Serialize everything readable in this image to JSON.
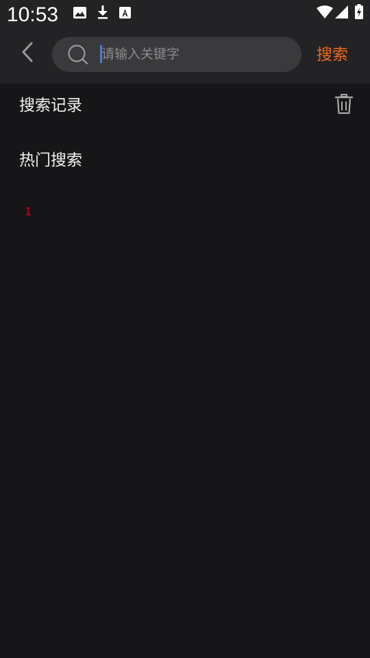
{
  "status_bar": {
    "time": "10:53",
    "icons": [
      "image-icon",
      "download-icon",
      "font-icon",
      "wifi-icon",
      "signal-icon",
      "battery-charging-icon"
    ]
  },
  "app_bar": {
    "back_icon": "chevron-left-icon",
    "search": {
      "placeholder": "请输入关键字",
      "value": ""
    },
    "search_label": "搜索"
  },
  "history": {
    "title": "搜索记录",
    "clear_icon": "trash-icon",
    "items": []
  },
  "hot": {
    "title": "热门搜索",
    "items": [
      {
        "rank": "1",
        "label": ""
      }
    ]
  },
  "colors": {
    "header_bg": "#232325",
    "page_bg": "#161618",
    "accent": "#ee6a1f",
    "rank_color": "#d0021b"
  }
}
